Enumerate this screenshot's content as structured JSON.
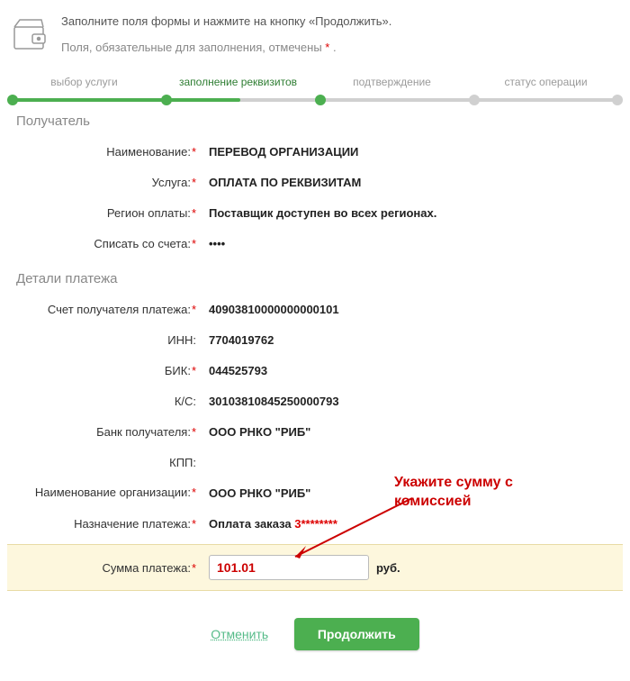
{
  "header": {
    "instruction": "Заполните поля формы и нажмите на кнопку «Продолжить».",
    "required_note_prefix": "Поля, обязательные для заполнения, отмечены ",
    "required_mark": "*",
    "required_note_suffix": " ."
  },
  "stepper": {
    "steps": [
      "выбор услуги",
      "заполнение реквизитов",
      "подтверждение",
      "статус операции"
    ]
  },
  "sections": {
    "receiver_title": "Получатель",
    "details_title": "Детали платежа"
  },
  "fields": {
    "name_label": "Наименование:",
    "name_value": "ПЕРЕВОД ОРГАНИЗАЦИИ",
    "service_label": "Услуга:",
    "service_value": "ОПЛАТА ПО РЕКВИЗИТАМ",
    "region_label": "Регион оплаты:",
    "region_value": "Поставщик доступен во всех регионах.",
    "account_label": "Списать со счета:",
    "account_value": "••••",
    "recipient_acc_label": "Счет получателя платежа:",
    "recipient_acc_value": "40903810000000000101",
    "inn_label": "ИНН:",
    "inn_value": "7704019762",
    "bik_label": "БИК:",
    "bik_value": "044525793",
    "ks_label": "К/С:",
    "ks_value": "30103810845250000793",
    "bank_label": "Банк получателя:",
    "bank_value": "ООО РНКО \"РИБ\"",
    "kpp_label": "КПП:",
    "kpp_value": "",
    "orgname_label": "Наименование организации:",
    "orgname_value": "ООО РНКО \"РИБ\"",
    "purpose_label": "Назначение платежа:",
    "purpose_prefix": "Оплата заказа ",
    "purpose_mask": "3********",
    "amount_label": "Сумма платежа:",
    "amount_value": "101.01",
    "currency": "руб."
  },
  "annotation": {
    "line1": "Укажите сумму с",
    "line2": "комиссией"
  },
  "buttons": {
    "cancel": "Отменить",
    "continue": "Продолжить"
  }
}
